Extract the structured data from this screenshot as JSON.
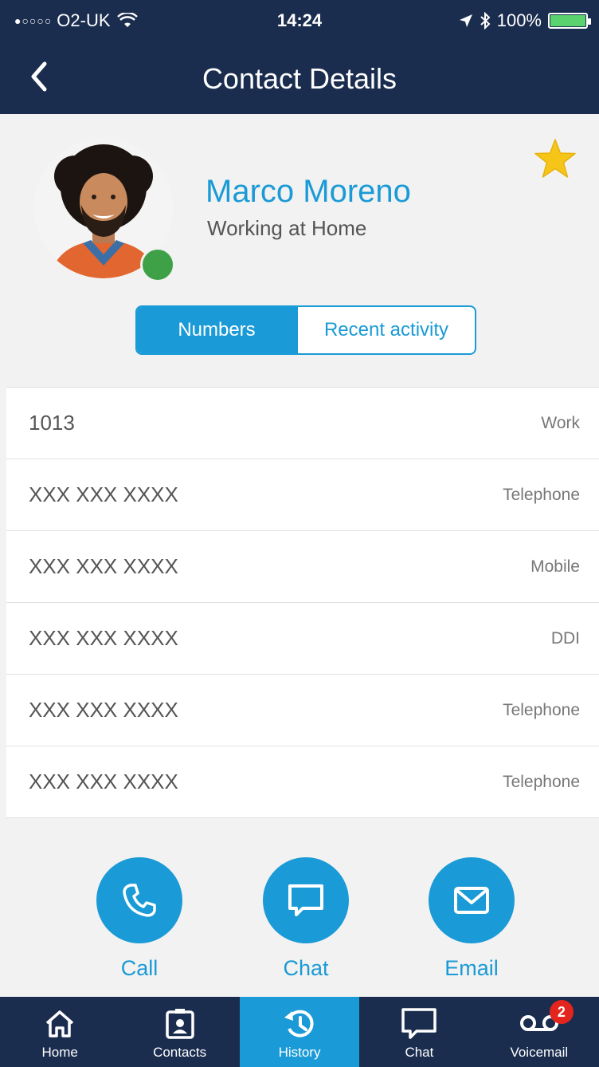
{
  "status_bar": {
    "signal_dots": "●○○○○",
    "carrier": "O2-UK",
    "time": "14:24",
    "battery": "100%",
    "battery_level": 1.0
  },
  "header": {
    "title": "Contact Details"
  },
  "contact": {
    "name": "Marco Moreno",
    "status": "Working at Home",
    "presence_color": "#3ea047",
    "favorite": true
  },
  "segment": {
    "active": "Numbers",
    "inactive": "Recent activity"
  },
  "numbers": [
    {
      "value": "1013",
      "type": "Work"
    },
    {
      "value": "XXX XXX XXXX",
      "type": "Telephone"
    },
    {
      "value": "XXX XXX XXXX",
      "type": "Mobile"
    },
    {
      "value": "XXX XXX XXXX",
      "type": "DDI"
    },
    {
      "value": "XXX XXX XXXX",
      "type": "Telephone"
    },
    {
      "value": "XXX XXX XXXX",
      "type": "Telephone"
    }
  ],
  "actions": {
    "call": "Call",
    "chat": "Chat",
    "email": "Email"
  },
  "tabs": [
    {
      "label": "Home",
      "icon": "home-icon"
    },
    {
      "label": "Contacts",
      "icon": "contacts-icon"
    },
    {
      "label": "History",
      "icon": "history-icon",
      "active": true
    },
    {
      "label": "Chat",
      "icon": "chat-icon"
    },
    {
      "label": "Voicemail",
      "icon": "voicemail-icon",
      "badge": "2"
    }
  ],
  "colors": {
    "navy": "#1b2d4f",
    "accent": "#1a9ad6",
    "star": "#f5c518",
    "badge": "#e3251d"
  }
}
